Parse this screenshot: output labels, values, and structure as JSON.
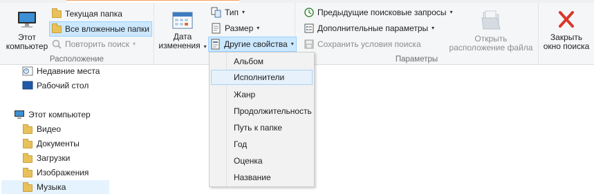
{
  "ribbon": {
    "location_group": {
      "label": "Расположение",
      "this_pc_label": "Этот\nкомпьютер",
      "current_folder": "Текущая папка",
      "all_subfolders": "Все вложенные папки",
      "repeat_search": "Повторить поиск"
    },
    "refine_group": {
      "date_modified": "Дата\nизменения",
      "type": "Тип",
      "size": "Размер",
      "other_props": "Другие свойства"
    },
    "options_group": {
      "label": "Параметры",
      "recent_searches": "Предыдущие поисковые запросы",
      "advanced_options": "Дополнительные параметры",
      "save_search": "Сохранить условия поиска",
      "open_location": "Открыть\nрасположение файла"
    },
    "close_group": {
      "close_search": "Закрыть\nокно поиска"
    }
  },
  "navigation": {
    "items": [
      {
        "label": "Недавние места",
        "icon": "recent-places-icon"
      },
      {
        "label": "Рабочий стол",
        "icon": "desktop-icon"
      },
      {
        "label": "Этот компьютер",
        "icon": "computer-icon"
      },
      {
        "label": "Видео",
        "icon": "folder-icon"
      },
      {
        "label": "Документы",
        "icon": "folder-icon"
      },
      {
        "label": "Загрузки",
        "icon": "folder-icon"
      },
      {
        "label": "Изображения",
        "icon": "folder-icon"
      },
      {
        "label": "Музыка",
        "icon": "folder-icon"
      }
    ]
  },
  "other_props_menu": {
    "items": [
      "Альбом",
      "Исполнители",
      "Жанр",
      "Продолжительность",
      "Путь к папке",
      "Год",
      "Оценка",
      "Название"
    ],
    "hovered": "Исполнители"
  },
  "colors": {
    "accent_selected": "#cce8ff",
    "close_x": "#d9372b",
    "folder": "#e8c15a"
  }
}
